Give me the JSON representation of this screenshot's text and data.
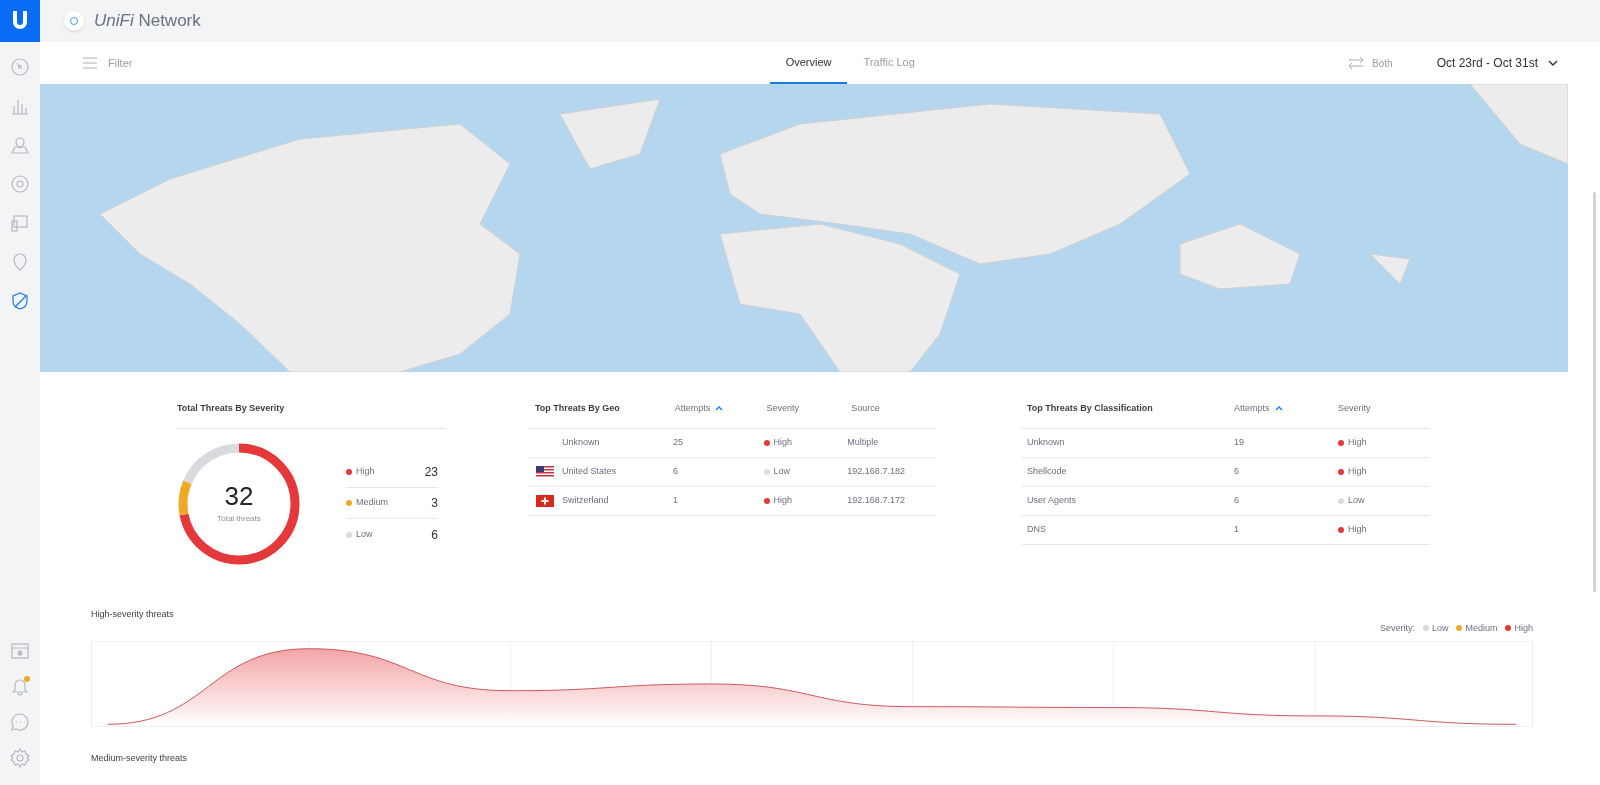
{
  "sidebar": {
    "items": [
      {
        "selected": false
      },
      {
        "selected": false
      },
      {
        "selected": false
      },
      {
        "selected": false
      },
      {
        "selected": false
      },
      {
        "selected": false
      },
      {
        "selected": true
      }
    ],
    "bottom_items": [
      {
        "selected": false,
        "notification": false
      },
      {
        "selected": false,
        "notification": true
      },
      {
        "selected": false,
        "notification": false
      },
      {
        "selected": false,
        "notification": false
      }
    ]
  },
  "header": {
    "title": "*UniFi* Network"
  },
  "toolbar": {
    "filter": "Filter",
    "tabs": [
      {
        "label": "Overview",
        "selected": true
      },
      {
        "label": "Traffic Log",
        "selected": false
      }
    ],
    "direction": "Both",
    "date_range": "Oct 23rd - Oct 31st"
  },
  "severity_card": {
    "title": "Total Threats By Severity",
    "total": "32",
    "total_label": "Total threats",
    "legend": [
      {
        "label": "High",
        "count": "23",
        "color": "#e5383b"
      },
      {
        "label": "Medium",
        "count": "3",
        "color": "#f0a925"
      },
      {
        "label": "Low",
        "count": "6",
        "color": "#d8dae0"
      }
    ]
  },
  "geo_table": {
    "columns": [
      "Top Threats By Geo",
      "Attempts",
      "Severity",
      "Source"
    ],
    "rows": [
      {
        "kind": "none",
        "country": "Unknown",
        "attempts": "25",
        "severity": "High",
        "color": "#e5383b",
        "source": "Multiple"
      },
      {
        "kind": "flag-us",
        "country": "United States",
        "attempts": "6",
        "severity": "Low",
        "color": "#d8dae0",
        "source": "192.168.7.182"
      },
      {
        "kind": "flag-ch",
        "country": "Switzerland",
        "attempts": "1",
        "severity": "High",
        "color": "#e5383b",
        "source": "192.168.7.172"
      }
    ]
  },
  "classification_table": {
    "columns": [
      "Top Threats By Classification",
      "Attempts",
      "Severity"
    ],
    "rows": [
      {
        "classification": "Unknown",
        "attempts": "19",
        "severity": "High",
        "color": "#e5383b"
      },
      {
        "classification": "Shellcode",
        "attempts": "6",
        "severity": "High",
        "color": "#e5383b"
      },
      {
        "classification": "User Agents",
        "attempts": "6",
        "severity": "Low",
        "color": "#d8dae0"
      },
      {
        "classification": "DNS",
        "attempts": "1",
        "severity": "High",
        "color": "#e5383b"
      }
    ]
  },
  "high_severity": {
    "title": "High-severity threats",
    "legend_label": "Severity:",
    "legend": [
      {
        "label": "Low",
        "color": "#d8dae0"
      },
      {
        "label": "Medium",
        "color": "#f0a925"
      },
      {
        "label": "High",
        "color": "#e5383b"
      }
    ]
  },
  "medium_severity": {
    "title": "Medium-severity threats"
  }
}
